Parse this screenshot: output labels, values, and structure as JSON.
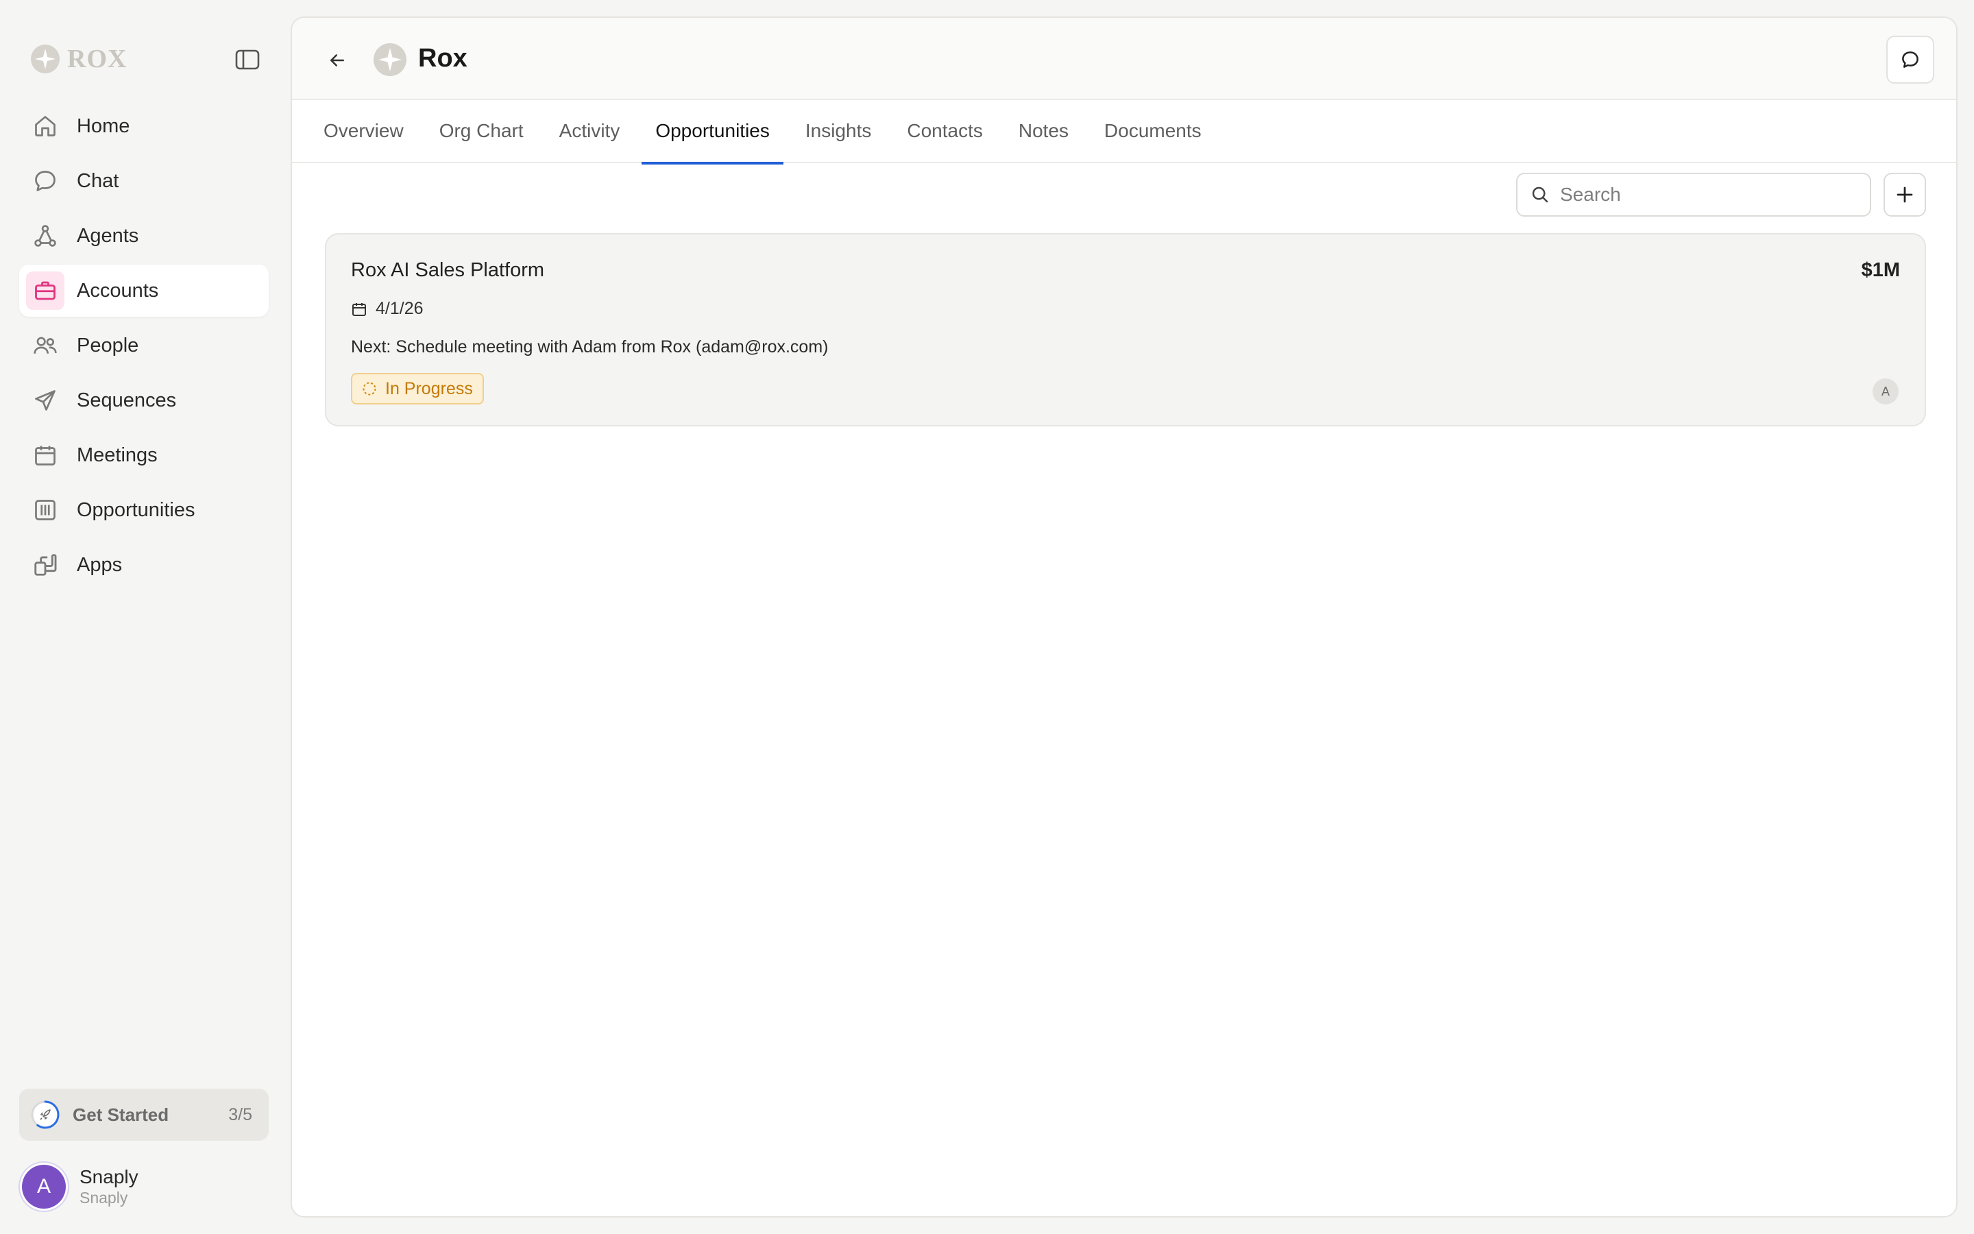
{
  "brand": {
    "name": "ROX",
    "logo_icon": "rox-star-logo"
  },
  "sidebar": {
    "collapse_icon": "sidebar-toggle-icon",
    "items": [
      {
        "label": "Home",
        "icon": "home-icon",
        "active": false
      },
      {
        "label": "Chat",
        "icon": "chat-bubble-icon",
        "active": false
      },
      {
        "label": "Agents",
        "icon": "agents-network-icon",
        "active": false
      },
      {
        "label": "Accounts",
        "icon": "briefcase-icon",
        "active": true
      },
      {
        "label": "People",
        "icon": "people-icon",
        "active": false
      },
      {
        "label": "Sequences",
        "icon": "paper-plane-icon",
        "active": false
      },
      {
        "label": "Meetings",
        "icon": "calendar-icon",
        "active": false
      },
      {
        "label": "Opportunities",
        "icon": "columns-icon",
        "active": false
      },
      {
        "label": "Apps",
        "icon": "apps-icon",
        "active": false
      }
    ],
    "get_started": {
      "label": "Get Started",
      "count": "3/5",
      "progress": 0.6
    },
    "user": {
      "initial": "A",
      "name": "Snaply",
      "org": "Snaply"
    }
  },
  "header": {
    "account_name": "Rox"
  },
  "tabs": [
    {
      "label": "Overview",
      "active": false
    },
    {
      "label": "Org Chart",
      "active": false
    },
    {
      "label": "Activity",
      "active": false
    },
    {
      "label": "Opportunities",
      "active": true
    },
    {
      "label": "Insights",
      "active": false
    },
    {
      "label": "Contacts",
      "active": false
    },
    {
      "label": "Notes",
      "active": false
    },
    {
      "label": "Documents",
      "active": false
    }
  ],
  "search": {
    "placeholder": "Search",
    "value": ""
  },
  "opportunities": [
    {
      "title": "Rox AI Sales Platform",
      "amount": "$1M",
      "date": "4/1/26",
      "next_step": "Next: Schedule meeting with Adam from Rox (adam@rox.com)",
      "status": "In Progress",
      "owner_initial": "A"
    }
  ],
  "colors": {
    "accent_tab": "#1f5fd6",
    "accounts_icon": "#e0357f",
    "status_text": "#c47a06",
    "avatar": "#7b4fc4"
  }
}
